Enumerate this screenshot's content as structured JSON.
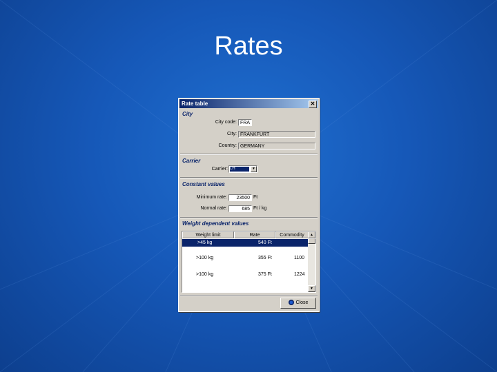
{
  "slide": {
    "title": "Rates"
  },
  "window": {
    "title": "Rate table",
    "close_glyph": "✕",
    "city": {
      "section": "City",
      "city_code_label": "City code:",
      "city_code_value": "FRA",
      "city_label": "City:",
      "city_value": "FRANKFURT",
      "country_label": "Country:",
      "country_value": "GERMANY"
    },
    "carrier": {
      "section": "Carrier",
      "carrier_label": "Carrier:",
      "carrier_value": "LH"
    },
    "constant": {
      "section": "Constant values",
      "minimum_label": "Minimum rate:",
      "minimum_value": "23500",
      "minimum_unit": "Ft",
      "normal_label": "Normal rate:",
      "normal_value": "685",
      "normal_unit": "Ft / kg"
    },
    "weight": {
      "section": "Weight dependent values",
      "columns": [
        "Weight limit",
        "Rate",
        "Commodity"
      ],
      "rows": [
        {
          "weight": ">45 kg",
          "rate": "540 Ft",
          "commodity": ""
        },
        {
          "weight": ">100 kg",
          "rate": "355 Ft",
          "commodity": "1100"
        },
        {
          "weight": ">100 kg",
          "rate": "375 Ft",
          "commodity": "1224"
        }
      ]
    },
    "close_button_label": "Close",
    "icons": {
      "close_button": "close-icon",
      "scroll_up": "arrow-up-icon",
      "scroll_down": "arrow-down-icon",
      "dropdown": "chevron-down-icon"
    }
  }
}
